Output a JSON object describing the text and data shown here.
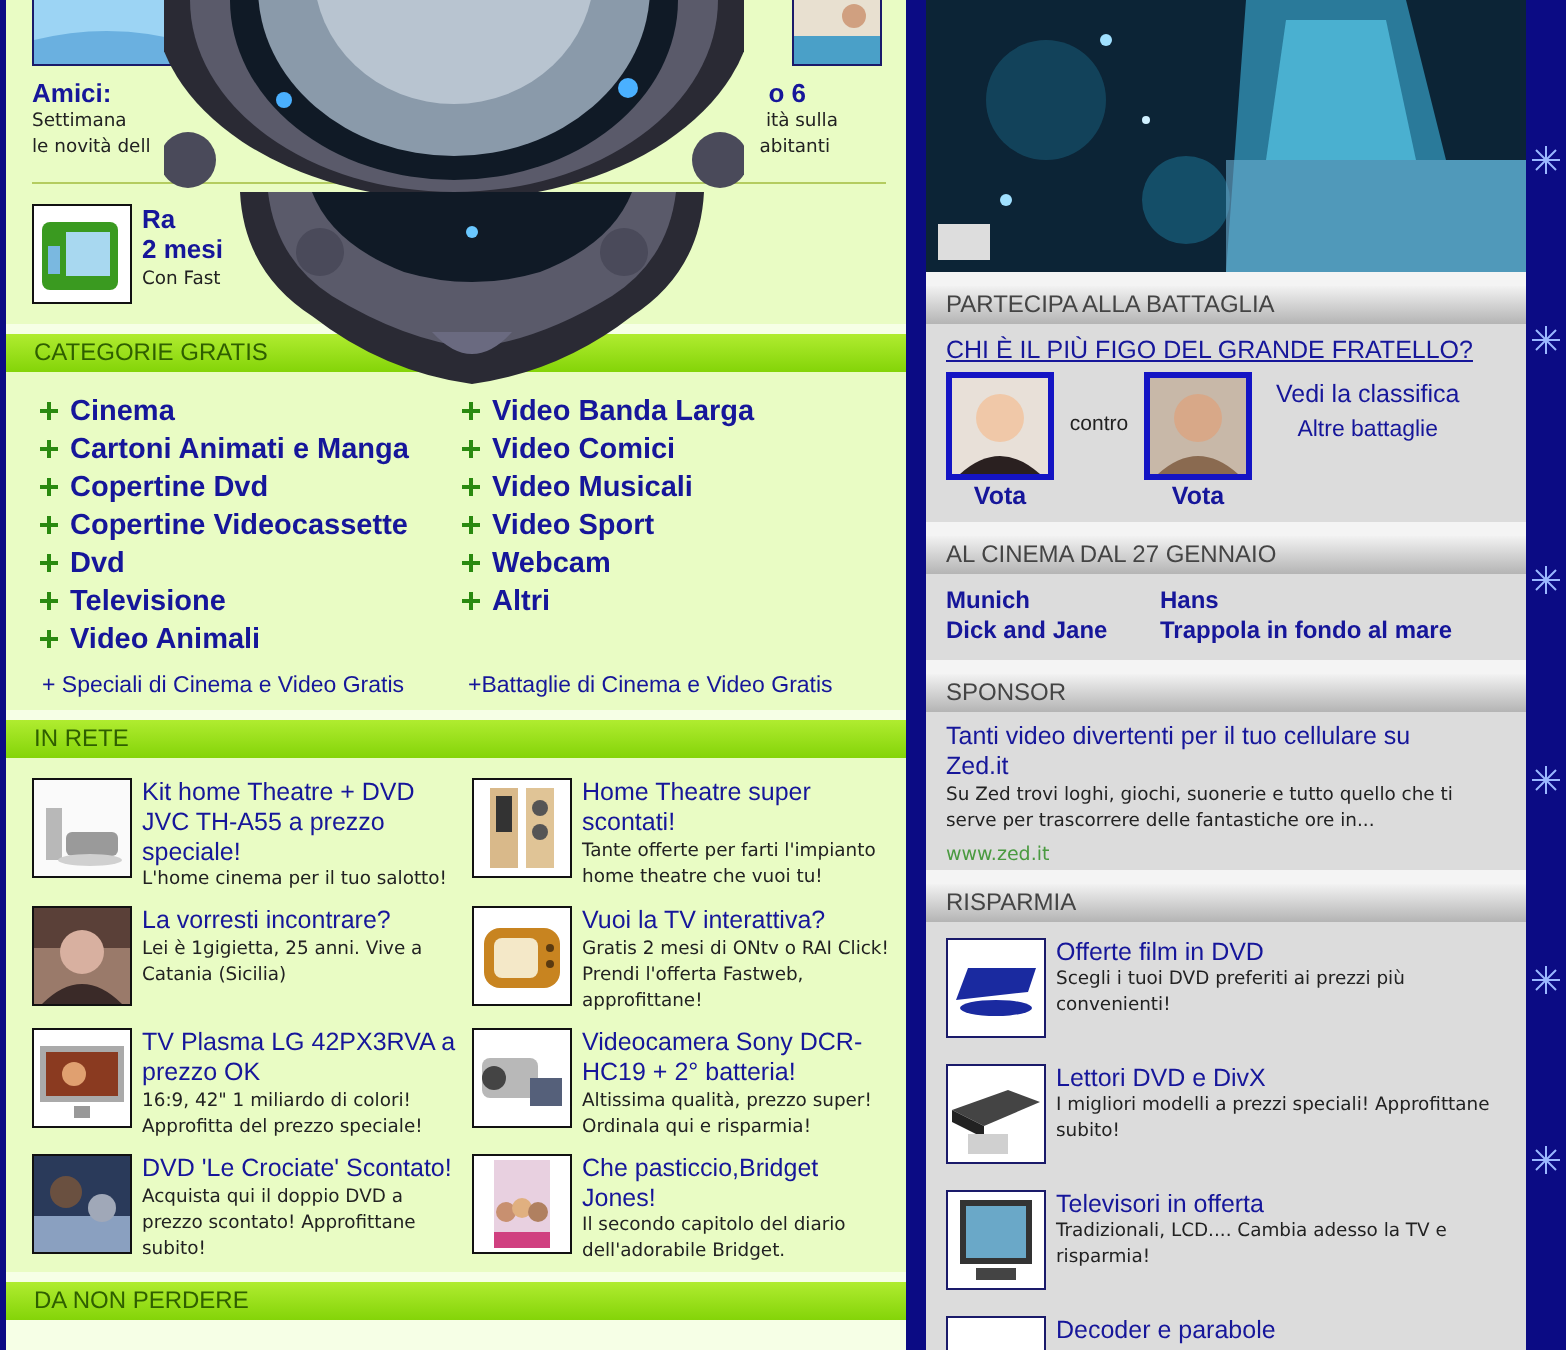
{
  "top_section": {
    "left_card": {
      "title": "Amici:",
      "lines": [
        "Settimana",
        "le novità dell"
      ]
    },
    "right_card": {
      "title": "o 6",
      "lines": [
        "ità sulla",
        "abitanti"
      ]
    },
    "promo": {
      "title_lines": [
        "Ra",
        "2 mesi"
      ],
      "text": "Con Fast"
    }
  },
  "categories": {
    "title": "CATEGORIE GRATIS",
    "columns": [
      [
        "Cinema",
        "Cartoni Animati e Manga",
        "Copertine Dvd",
        "Copertine Videocassette",
        "Dvd",
        "Televisione",
        "Video Animali"
      ],
      [
        "Video Banda Larga",
        "Video Comici",
        "Video Musicali",
        "Video Sport",
        "Webcam",
        "Altri"
      ]
    ],
    "links": [
      "+ Speciali di Cinema e Video Gratis",
      "+Battaglie di Cinema e Video Gratis"
    ]
  },
  "in_rete": {
    "title": "IN RETE",
    "items": [
      {
        "title": "Kit home Theatre + DVD JVC TH-A55 a prezzo speciale!",
        "text": "L'home cinema per il tuo salotto!"
      },
      {
        "title": "Home Theatre super scontati!",
        "text": "Tante offerte per farti l'impianto home theatre che vuoi tu!"
      },
      {
        "title": "La vorresti incontrare?",
        "text": "Lei è 1gigietta, 25 anni. Vive a Catania (Sicilia)"
      },
      {
        "title": "Vuoi la TV interattiva?",
        "text": "Gratis 2 mesi di ONtv o RAI Click! Prendi l'offerta Fastweb, approfittane!"
      },
      {
        "title": "TV Plasma LG 42PX3RVA a prezzo OK",
        "text": "16:9, 42\" 1 miliardo di colori! Approfitta del prezzo speciale!"
      },
      {
        "title": "Videocamera Sony DCR-HC19 + 2° batteria!",
        "text": "Altissima qualità, prezzo super! Ordinala qui e risparmia!"
      },
      {
        "title": "DVD 'Le Crociate' Scontato!",
        "text": "Acquista qui il doppio DVD a prezzo scontato! Approfittane subito!"
      },
      {
        "title": "Che pasticcio,Bridget Jones!",
        "text": "Il secondo capitolo del diario dell'adorabile Bridget."
      }
    ]
  },
  "da_non_perdere": {
    "title": "DA NON PERDERE"
  },
  "battle": {
    "title": "PARTECIPA ALLA BATTAGLIA",
    "question": "CHI È IL PIÙ FIGO DEL GRANDE FRATELLO?",
    "contenders": [
      {
        "vote": "Vota"
      },
      {
        "vote": "Vota"
      }
    ],
    "versus": "contro",
    "links": [
      "Vedi la classifica",
      "Altre battaglie"
    ]
  },
  "cinema": {
    "title": "AL CINEMA DAL 27 GENNAIO",
    "films": [
      "Munich",
      "Hans",
      "Dick and Jane",
      "Trappola in fondo al mare"
    ]
  },
  "sponsor": {
    "title": "SPONSOR",
    "headline": "Tanti video divertenti per il tuo cellulare su Zed.it",
    "text": "Su Zed trovi loghi, giochi, suonerie e tutto quello che ti serve per trascorrere delle fantastiche ore in...",
    "url": "www.zed.it"
  },
  "risparmia": {
    "title": "RISPARMIA",
    "items": [
      {
        "title": "Offerte film in DVD",
        "text": "Scegli i tuoi DVD preferiti ai prezzi più convenienti!"
      },
      {
        "title": "Lettori DVD e DivX",
        "text": "I migliori modelli a prezzi speciali! Approfittane subito!"
      },
      {
        "title": "Televisori in offerta",
        "text": "Tradizionali, LCD.... Cambia adesso la TV e risparmia!"
      },
      {
        "title": "Decoder e parabole"
      }
    ]
  }
}
